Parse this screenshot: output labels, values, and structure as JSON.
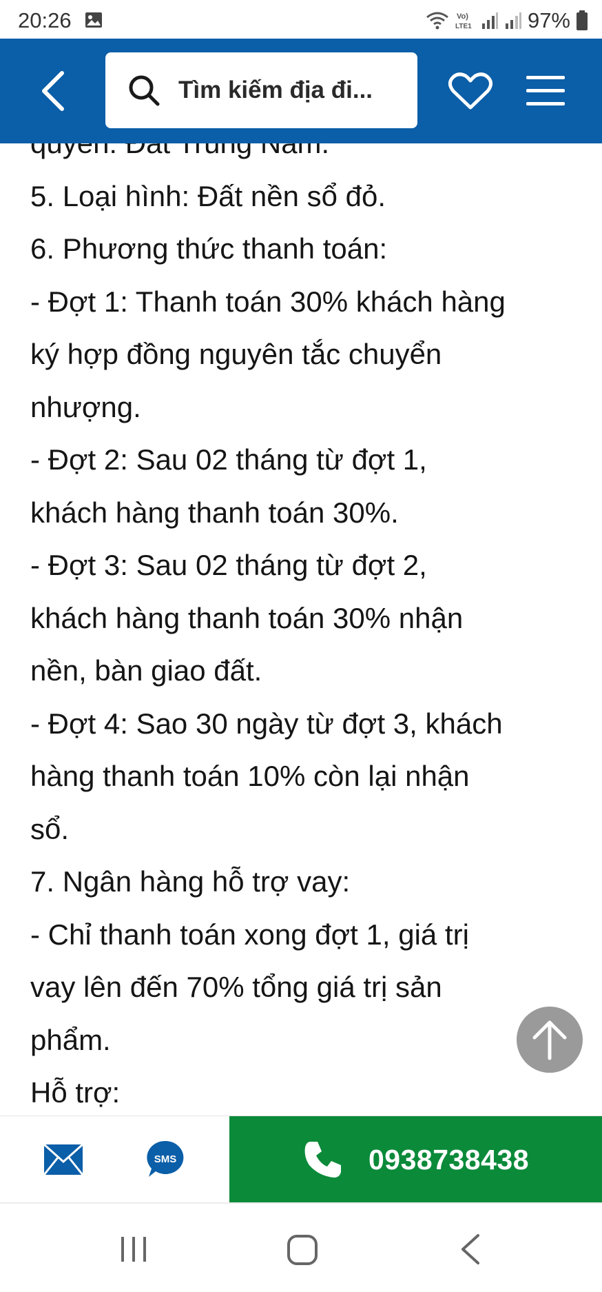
{
  "status_bar": {
    "time": "20:26",
    "battery": "97%",
    "icons": [
      "gallery-icon",
      "wifi-icon",
      "volte-icon",
      "signal-icon",
      "signal-icon",
      "battery-icon"
    ]
  },
  "header": {
    "search_placeholder": "Tìm kiếm địa đi...",
    "icons": [
      "back-arrow-icon",
      "search-icon",
      "heart-icon",
      "hamburger-menu-icon"
    ],
    "background_color": "#0b5ea8"
  },
  "content": {
    "lines": [
      "quyền: Đất Trung Nam.",
      "5. Loại hình: Đất nền sổ đỏ.",
      "6. Phương thức thanh toán:",
      "- Đợt 1: Thanh toán 30% khách hàng",
      "ký hợp đồng nguyên tắc chuyển",
      "nhượng.",
      "- Đợt 2: Sau 02 tháng từ đợt 1,",
      "khách hàng thanh toán 30%.",
      "- Đợt 3: Sau 02 tháng từ đợt 2,",
      "khách hàng thanh toán 30% nhận",
      "nền, bàn giao đất.",
      "- Đợt 4: Sao 30 ngày từ đợt 3, khách",
      "hàng thanh toán 10% còn lại nhận",
      "sổ.",
      "7. Ngân hàng hỗ trợ vay:",
      "- Chỉ thanh toán xong đợt 1, giá trị",
      "vay lên đến 70% tổng giá trị sản",
      "phẩm.",
      "Hỗ trợ:"
    ]
  },
  "contact_bar": {
    "phone": "0938738438",
    "icons": [
      "email-icon",
      "sms-icon",
      "phone-icon"
    ],
    "call_color": "#0b8a3a"
  },
  "nav_bar": {
    "icons": [
      "recent-apps-icon",
      "home-icon",
      "back-icon"
    ]
  },
  "fab": {
    "icon": "arrow-up-icon"
  }
}
